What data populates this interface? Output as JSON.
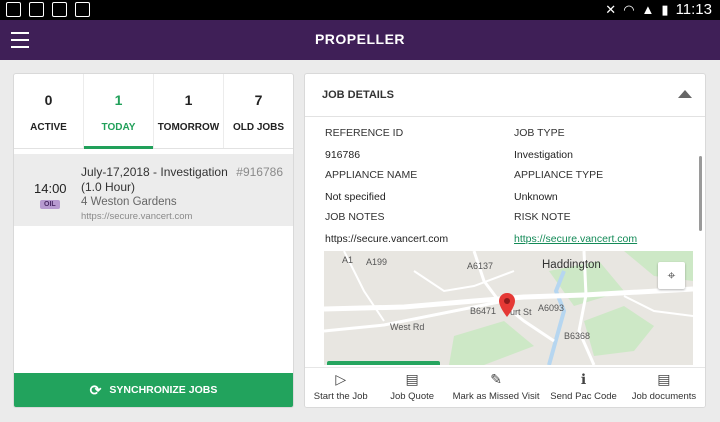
{
  "status_bar": {
    "time": "11:13"
  },
  "app": {
    "title": "PROPELLER"
  },
  "tabs": [
    {
      "count": "0",
      "label": "ACTIVE"
    },
    {
      "count": "1",
      "label": "TODAY"
    },
    {
      "count": "1",
      "label": "TOMORROW"
    },
    {
      "count": "7",
      "label": "OLD JOBS"
    }
  ],
  "job": {
    "time": "14:00",
    "badge": "OIL",
    "title": "July-17,2018 - Investigation (1.0 Hour)",
    "address": "4 Weston Gardens",
    "url": "https://secure.vancert.com",
    "number": "#916786"
  },
  "sync_button": {
    "label": "SYNCHRONIZE JOBS"
  },
  "job_details": {
    "header": "JOB DETAILS",
    "reference_id": {
      "label": "REFERENCE ID",
      "value": "916786"
    },
    "job_type": {
      "label": "JOB TYPE",
      "value": "Investigation"
    },
    "appliance_name": {
      "label": "APPLIANCE NAME",
      "value": "Not specified"
    },
    "appliance_type": {
      "label": "APPLIANCE TYPE",
      "value": "Unknown"
    },
    "job_notes": {
      "label": "JOB NOTES",
      "value": "https://secure.vancert.com"
    },
    "risk_note": {
      "label": "RISK NOTE",
      "value": "https://secure.vancert.com"
    }
  },
  "map": {
    "town": "Haddington",
    "roads": {
      "a199": "A199",
      "a1": "A1",
      "b6471": "B6471",
      "a6093": "A6093",
      "west_rd": "West Rd",
      "court_st": "urt St",
      "b6368": "B6368",
      "a6137": "A6137"
    }
  },
  "actions": [
    {
      "label": "Start the Job",
      "icon": "play-icon"
    },
    {
      "label": "Job Quote",
      "icon": "document-icon"
    },
    {
      "label": "Mark as Missed Visit",
      "icon": "pencil-icon"
    },
    {
      "label": "Send Pac Code",
      "icon": "info-icon"
    },
    {
      "label": "Job documents",
      "icon": "document-icon"
    }
  ],
  "colors": {
    "app_bar": "#3f1f57",
    "accent_green": "#21a05a",
    "link_green": "#138a57"
  }
}
